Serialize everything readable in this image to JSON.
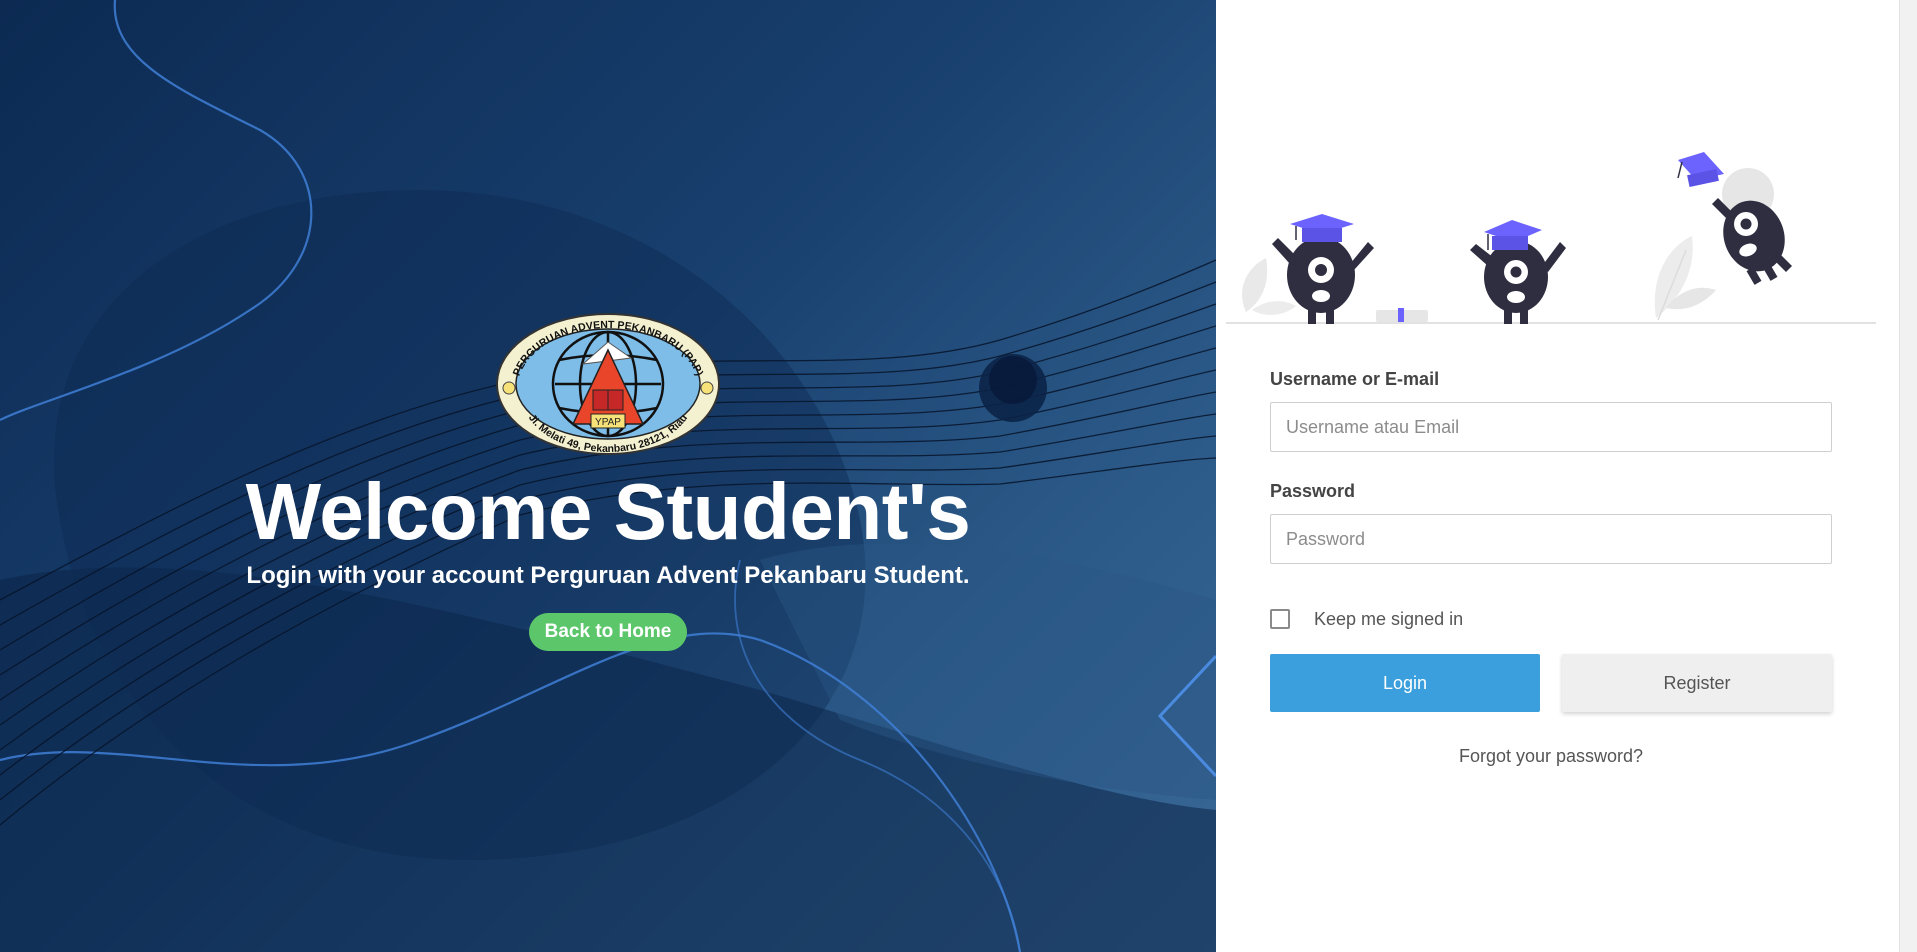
{
  "hero": {
    "logo": {
      "icon": "school-logo-icon",
      "ring_top_text": "PERGURUAN ADVENT PEKANBARU (PAP)",
      "ring_bottom_text": "Jl. Melati 49, Pekanbaru 28121, Riau",
      "badge_text": "YPAP"
    },
    "title": "Welcome Student's",
    "subtitle": "Login with your account Perguruan Advent Pekanbaru Student.",
    "back_button": "Back to Home"
  },
  "illustration": {
    "icon": "graduation-mascots-illustration"
  },
  "form": {
    "username_label": "Username or E-mail",
    "username_placeholder": "Username atau Email",
    "username_value": "",
    "password_label": "Password",
    "password_placeholder": "Password",
    "password_value": "",
    "remember_label": "Keep me signed in",
    "remember_checked": false,
    "login_button": "Login",
    "register_button": "Register",
    "forgot_link": "Forgot your password?"
  },
  "colors": {
    "hero_dark": "#0c2a52",
    "hero_light": "#3a6897",
    "home_button": "#5cc66b",
    "login_button": "#3a9fdc",
    "register_button": "#efefef",
    "graduation_cap": "#6c63ff",
    "mascot": "#2f2e41"
  }
}
